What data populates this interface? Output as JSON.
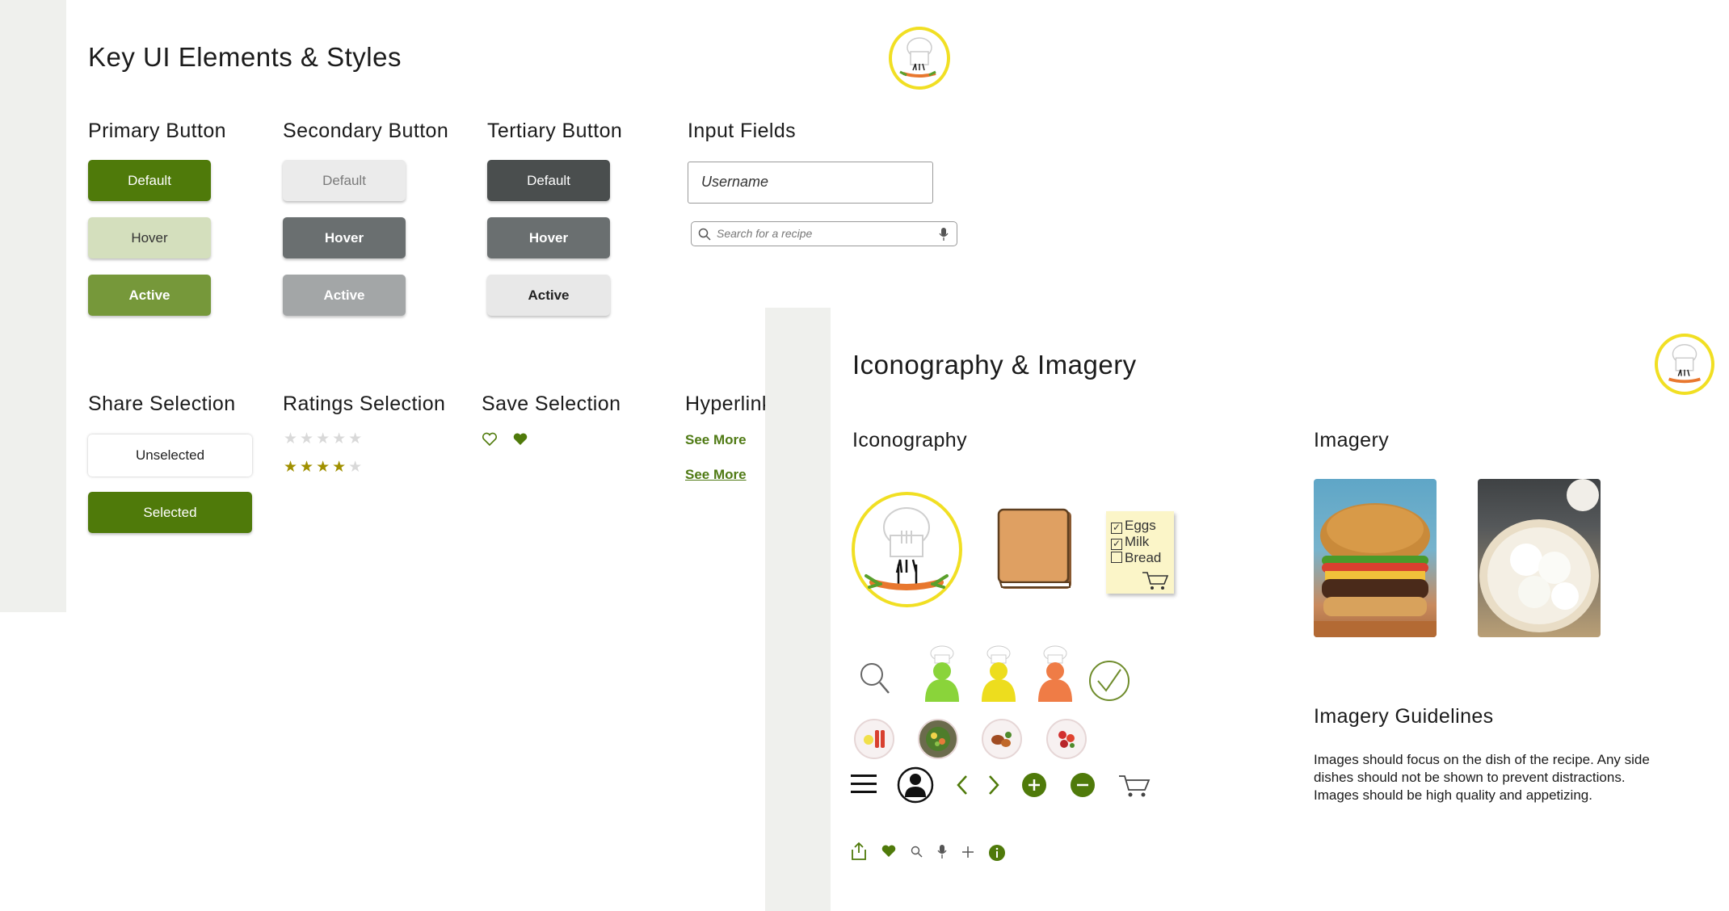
{
  "left_sheet": {
    "title": "Key UI Elements & Styles",
    "primary": {
      "heading": "Primary Button",
      "default": "Default",
      "hover": "Hover",
      "active": "Active"
    },
    "secondary": {
      "heading": "Secondary Button",
      "default": "Default",
      "hover": "Hover",
      "active": "Active"
    },
    "tertiary": {
      "heading": "Tertiary Button",
      "default": "Default",
      "hover": "Hover",
      "active": "Active"
    },
    "inputs": {
      "heading": "Input Fields",
      "username_placeholder": "Username",
      "search_placeholder": "Search for a recipe"
    },
    "share": {
      "heading": "Share Selection",
      "unselected": "Unselected",
      "selected": "Selected"
    },
    "ratings": {
      "heading": "Ratings Selection",
      "empty_stars": "★★★★★",
      "filled_stars": "★★★★",
      "remaining_star": "★",
      "filled_rating": 4,
      "max_rating": 5
    },
    "save": {
      "heading": "Save Selection"
    },
    "hyperlinks": {
      "heading": "Hyperlinks",
      "link_default": "See More",
      "link_hover": "See More"
    }
  },
  "right_sheet": {
    "title": "Iconography & Imagery",
    "iconography": {
      "heading": "Iconography"
    },
    "grocery_list": {
      "items": [
        "Eggs",
        "Milk",
        "Bread"
      ],
      "checked": [
        true,
        true,
        false
      ]
    },
    "imagery": {
      "heading": "Imagery"
    },
    "guidelines": {
      "heading": "Imagery Guidelines",
      "lines": [
        "Images should focus on the dish of the recipe. Any side",
        "dishes should not be shown to prevent distractions.",
        "Images should be high quality and appetizing."
      ]
    }
  },
  "colors": {
    "primary_green": "#4f7a0a",
    "primary_hover": "#d4dfbd",
    "primary_active": "#76983a",
    "dark_gray": "#4a4e4e",
    "mid_gray": "#6a6f70",
    "light_gray": "#a3a6a7",
    "logo_yellow": "#f1df23",
    "strip_gray": "#eff0ed"
  }
}
